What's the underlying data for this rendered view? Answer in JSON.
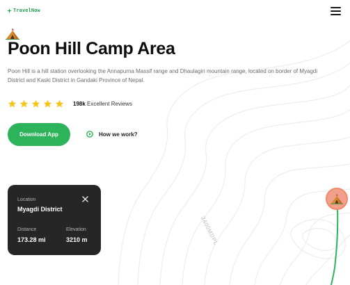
{
  "header": {
    "logo_text": "TravelNow",
    "menu_icon": "hamburger-menu-icon"
  },
  "hero": {
    "title": "Poon Hill Camp Area",
    "description": "Poon Hill is a hill station overlooking the Annapurna Massif range and Dhaulagiri mountain range, located on border of Myagdi District and Kaski District in Gandaki Province of Nepal.",
    "rating": {
      "stars": 5,
      "count": "198k",
      "label": "Excellent Reviews"
    },
    "download_label": "Download App",
    "how_label": "How we work?"
  },
  "map": {
    "altitude_label": "2400MDPL"
  },
  "location_card": {
    "location_label": "Location",
    "location_value": "Myagdi District",
    "distance_label": "Distance",
    "distance_value": "173.28 mi",
    "elevation_label": "Elevation",
    "elevation_value": "3210 m"
  },
  "colors": {
    "accent": "#2db35a",
    "card_bg": "#262626",
    "star": "#f5c518",
    "pin": "#f2a08b"
  }
}
